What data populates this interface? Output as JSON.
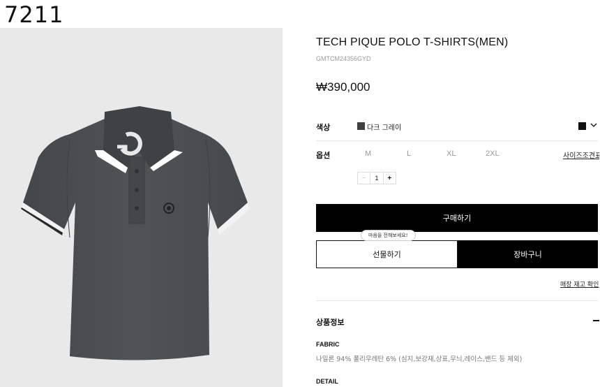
{
  "header": {
    "number": "7211"
  },
  "product": {
    "title": "TECH PIQUE POLO T-SHIRTS(MEN)",
    "code": "GMTCM24356GYD",
    "price": "₩390,000",
    "image_alt": "Dark gray polo shirt"
  },
  "color": {
    "label": "색상",
    "selected_name": "다크 그레이",
    "swatch_color": "#404040",
    "selector_swatch_color": "#111111"
  },
  "options": {
    "label": "옵션",
    "sizes": [
      "M",
      "L",
      "XL",
      "2XL"
    ],
    "size_guide": "사이즈조견표"
  },
  "quantity": {
    "minus": "−",
    "value": "1",
    "plus": "+"
  },
  "actions": {
    "buy": "구매하기",
    "gift": "선물하기",
    "gift_tooltip": "마음을 전해보세요!",
    "cart": "장바구니",
    "stock_check": "매장 재고 확인"
  },
  "details": {
    "section_title": "상품정보",
    "fabric_label": "FABRIC",
    "fabric_text": "나일론 94% 폴리우레탄 6% (심지,보강재,상표,무늬,레이스,밴드 등 제외)",
    "detail_label": "DETAIL"
  },
  "colors": {
    "accent": "#000000",
    "shirt": "#4a4d50",
    "panel_bg": "#e9e9e9"
  }
}
